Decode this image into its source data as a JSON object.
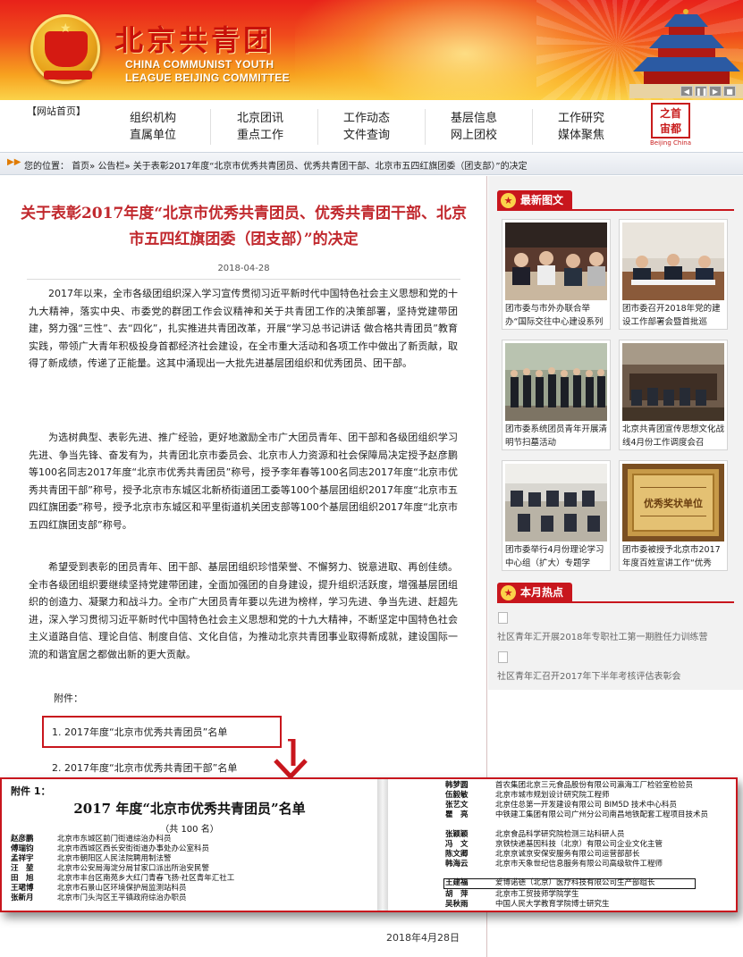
{
  "header": {
    "title": "北京共青团",
    "subtitle_en_line1": "CHINA COMMUNIST YOUTH",
    "subtitle_en_line2": "LEAGUE BEIJING COMMITTEE",
    "emblem_text": "中国共青团"
  },
  "nav": {
    "home": "【网站首页】",
    "columns": [
      {
        "top": "组织机构",
        "bottom": "直属单位"
      },
      {
        "top": "北京团讯",
        "bottom": "重点工作"
      },
      {
        "top": "工作动态",
        "bottom": "文件查询"
      },
      {
        "top": "基层信息",
        "bottom": "网上团校"
      },
      {
        "top": "工作研究",
        "bottom": "媒体聚焦"
      }
    ],
    "logo_line1": "之首",
    "logo_line2": "宙都",
    "logo_sub": "Beijing China"
  },
  "breadcrumb": {
    "label": "您的位置：",
    "path": "首页» 公告栏» 关于表彰2017年度“北京市优秀共青团员、优秀共青团干部、北京市五四红旗团委（团支部）”的决定"
  },
  "article": {
    "title": "关于表彰2017年度“北京市优秀共青团员、优秀共青团干部、北京市五四红旗团委（团支部）”的决定",
    "date": "2018-04-28",
    "paragraphs": [
      "2017年以来，全市各级团组织深入学习宣传贯彻习近平新时代中国特色社会主义思想和党的十九大精神，落实中央、市委党的群团工作会议精神和关于共青团工作的决策部署，坚持党建带团建，努力强“三性”、去“四化”，扎实推进共青团改革，开展“学习总书记讲话 做合格共青团员”教育实践，带领广大青年积极投身首都经济社会建设，在全市重大活动和各项工作中做出了新贡献，取得了新成绩，传递了正能量。这其中涌现出一大批先进基层团组织和优秀团员、团干部。",
      "为选树典型、表彰先进、推广经验，更好地激励全市广大团员青年、团干部和各级团组织学习先进、争当先锋、奋发有为，共青团北京市委员会、北京市人力资源和社会保障局决定授予赵彦鹏等100名同志2017年度“北京市优秀共青团员”称号，授予李年春等100名同志2017年度“北京市优秀共青团干部”称号，授予北京市东城区北新桥街道团工委等100个基层团组织2017年度“北京市五四红旗团委”称号，授予北京市东城区和平里街道机关团支部等100个基层团组织2017年度“北京市五四红旗团支部”称号。",
      "希望受到表彰的团员青年、团干部、基层团组织珍惜荣誉、不懈努力、锐意进取、再创佳绩。全市各级团组织要继续坚持党建带团建，全面加强团的自身建设，提升组织活跃度，增强基层团组织的创造力、凝聚力和战斗力。全市广大团员青年要以先进为榜样，学习先进、争当先进、赶超先进，深入学习贯彻习近平新时代中国特色社会主义思想和党的十九大精神，不断坚定中国特色社会主义道路自信、理论自信、制度自信、文化自信，为推动北京共青团事业取得新成就，建设国际一流的和谐宜居之都做出新的更大贡献。"
    ],
    "attachment_label": "附件：",
    "attachments": [
      "1. 2017年度“北京市优秀共青团员”名单",
      "2. 2017年度“北京市优秀共青团干部”名单"
    ],
    "signature_date": "2018年4月28日"
  },
  "document_image": {
    "attachment_head": "附件 1：",
    "title": "2017 年度“北京市优秀共青团员”名单",
    "count": "（共 100 名）",
    "left_rows": [
      {
        "name": "赵彦鹏",
        "unit": "北京市东城区前门街道综治办科员"
      },
      {
        "name": "傅瑞钧",
        "unit": "北京市西城区西长安街街道办事处办公室科员"
      },
      {
        "name": "孟祥宇",
        "unit": "北京市朝阳区人民法院聘用制法警"
      },
      {
        "name": "汪　堃",
        "unit": "北京市公安局海淀分局甘家口派出所治安民警"
      },
      {
        "name": "田　旭",
        "unit": "北京市丰台区南苑乡大红门青春飞扬·社区青年汇社工"
      },
      {
        "name": "王珺博",
        "unit": "北京市石景山区环境保护局监测站科员"
      },
      {
        "name": "张新月",
        "unit": "北京市门头沟区王平镇政府综治办职员"
      }
    ],
    "right_rows": [
      {
        "name": "韩梦圆",
        "unit": "首农集团北京三元食品股份有限公司瀛海工厂检验室检验员"
      },
      {
        "name": "伍毅敏",
        "unit": "北京市城市规划设计研究院工程师"
      },
      {
        "name": "张艺文",
        "unit": "北京住总第一开发建设有限公司 BIM5D 技术中心科员"
      },
      {
        "name": "瞿　亮",
        "unit": "中铁建工集团有限公司广州分公司南昌地铁配套工程项目技术员"
      },
      {
        "name": "张颖颖",
        "unit": "北京食品科学研究院检测三站科研人员"
      },
      {
        "name": "冯　文",
        "unit": "京铁快递基因科技（北京）有限公司企业文化主管"
      },
      {
        "name": "陈文卿",
        "unit": "北京京诚京安保安服务有限公司运营部部长"
      },
      {
        "name": "韩海云",
        "unit": "北京市天象世纪信息服务有限公司高级软件工程师"
      },
      {
        "name": "王建福",
        "unit": "爱博诺德（北京）医疗科技有限公司生产部组长"
      },
      {
        "name": "胡　萍",
        "unit": "北京市工贸技师学院学生"
      },
      {
        "name": "吴秋雨",
        "unit": "中国人民大学教育学院博士研究生"
      }
    ]
  },
  "sidebar": {
    "latest_title": "最新图文",
    "cards": [
      {
        "caption": "团市委与市外办联合举办“国际交往中心建设系列"
      },
      {
        "caption": "团市委召开2018年党的建设工作部署会暨首批巡"
      },
      {
        "caption": "团市委系统团员青年开展清明节扫墓活动"
      },
      {
        "caption": "北京共青团宣传思想文化战线4月份工作调度会召"
      },
      {
        "caption": "团市委举行4月份理论学习中心组（扩大）专题学"
      },
      {
        "caption": "团市委被授予北京市2017年度百姓宣讲工作“优秀"
      }
    ],
    "plaque_text": "优秀奖状单位",
    "hot_title": "本月热点",
    "hot_items": [
      "社区青年汇开展2018年专职社工第一期胜任力训练营",
      "社区青年汇召开2017年下半年考核评估表彰会"
    ]
  },
  "colors": {
    "brand_red": "#c8161d",
    "title_red": "#c1282d",
    "banner_orange": "#f04a1c",
    "banner_gold": "#fbd34a"
  }
}
